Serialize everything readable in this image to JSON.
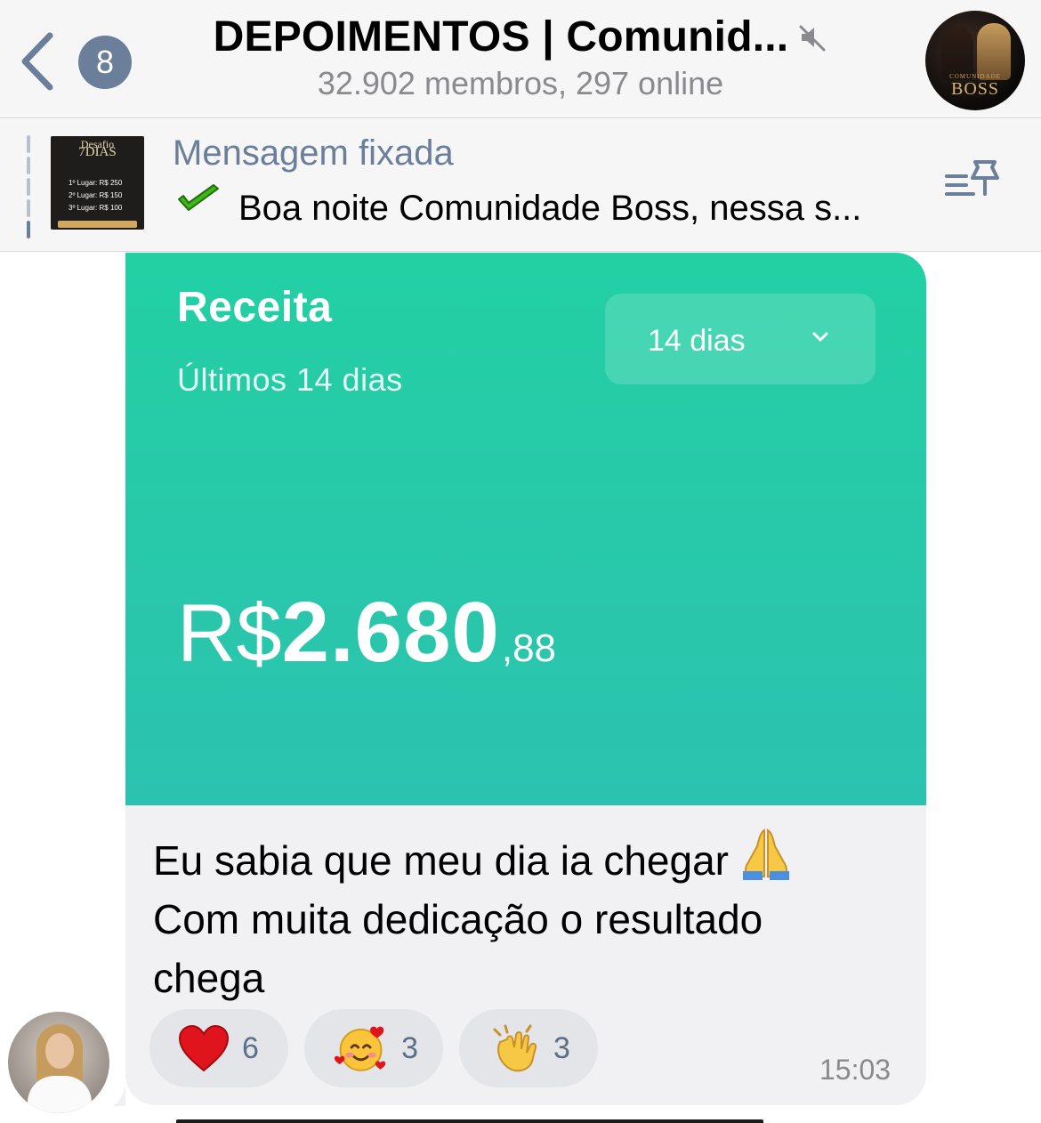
{
  "header": {
    "back_badge": "8",
    "title": "DEPOIMENTOS | Comunid...",
    "subtitle": "32.902 membros, 297 online",
    "group_avatar": {
      "small_text": "COMUNIDADE",
      "brand": "BOSS"
    }
  },
  "pinned": {
    "label": "Mensagem fixada",
    "text": "Boa noite Comunidade Boss, nessa s...",
    "thumb": {
      "line1": "Desafio",
      "line2": "7DIAS",
      "rows": [
        "1º Lugar: R$ 250",
        "2º Lugar: R$ 150",
        "3º Lugar: R$ 100"
      ]
    }
  },
  "message": {
    "image": {
      "title": "Receita",
      "subtitle": "Últimos 14 dias",
      "period_select": "14 dias",
      "amount_currency": "R$",
      "amount_int": "2.680",
      "amount_cents": ",88"
    },
    "text_lines": [
      "Eu sabia que meu dia ia chegar",
      "Com muita dedicação o resultado",
      "chega"
    ],
    "reactions": [
      {
        "icon": "heart-icon",
        "count": "6"
      },
      {
        "icon": "smiling-face-with-hearts-icon",
        "count": "3"
      },
      {
        "icon": "clapping-hands-icon",
        "count": "3"
      }
    ],
    "time": "15:03"
  },
  "colors": {
    "accent": "#6b7f9a",
    "receipt_green": "#22d0a3",
    "bubble": "#f1f1f4",
    "header_bg": "#f6f6f7"
  }
}
